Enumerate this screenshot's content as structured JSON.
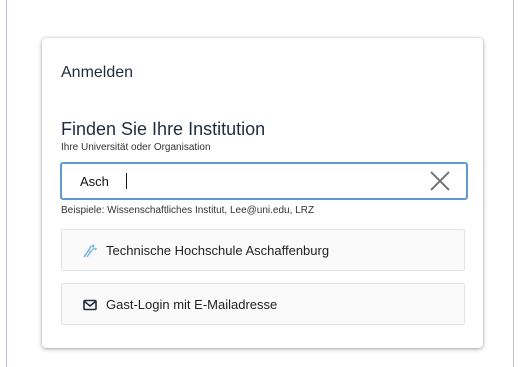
{
  "card": {
    "title": "Anmelden"
  },
  "search_section": {
    "heading": "Finden Sie Ihre Institution",
    "subheading": "Ihre Universität oder Organisation",
    "input_value": "Asch",
    "hint": "Beispiele: Wissenschaftliches Institut, Lee@uni.edu, LRZ"
  },
  "options": [
    {
      "label": "Technische Hochschule Aschaffenburg",
      "icon": "institution-logo-icon"
    },
    {
      "label": "Gast-Login mit E-Mailadresse",
      "icon": "envelope-icon"
    }
  ],
  "colors": {
    "input_border": "#5b9bd5",
    "logo": "#7fb9e0"
  }
}
